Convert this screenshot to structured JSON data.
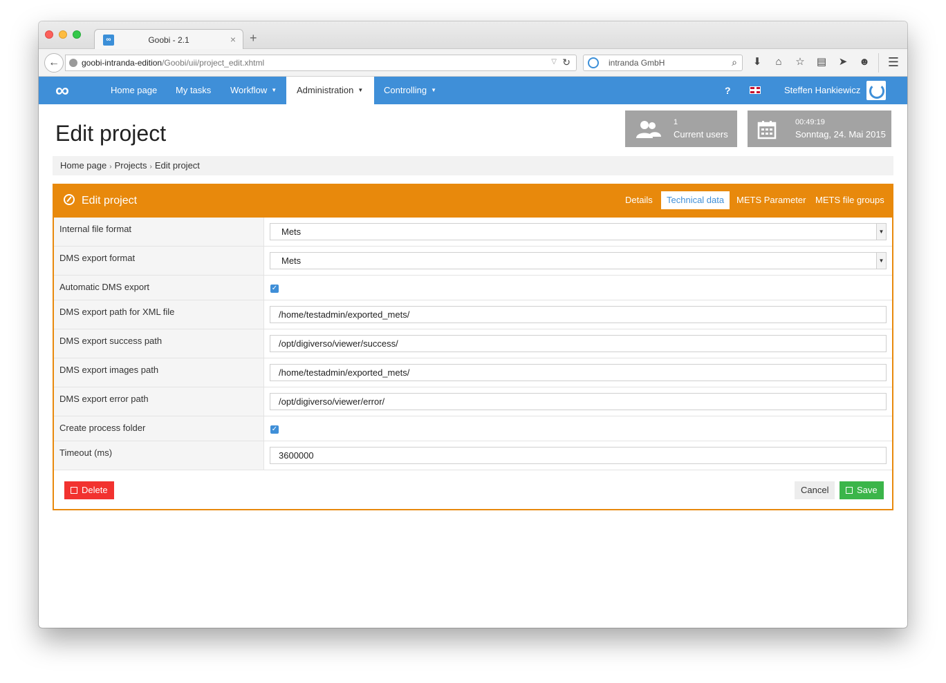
{
  "browser": {
    "tab_title": "Goobi - 2.1",
    "tab_favicon": "∞",
    "url_host": "goobi-intranda-edition",
    "url_path": "/Goobi/uii/project_edit.xhtml",
    "search_engine": "intranda GmbH"
  },
  "navbar": {
    "logo": "∞",
    "items": [
      {
        "label": "Home page"
      },
      {
        "label": "My tasks"
      },
      {
        "label": "Workflow"
      },
      {
        "label": "Administration"
      },
      {
        "label": "Controlling"
      }
    ],
    "help": "?",
    "user": "Steffen Hankiewicz"
  },
  "header": {
    "title": "Edit project",
    "users_count": "1",
    "users_label": "Current users",
    "time": "00:49:19",
    "date": "Sonntag, 24. Mai 2015"
  },
  "breadcrumb": [
    "Home page",
    "Projects",
    "Edit project"
  ],
  "panel": {
    "title": "Edit project",
    "tabs": [
      "Details",
      "Technical data",
      "METS Parameter",
      "METS file groups"
    ],
    "active_tab": "Technical data"
  },
  "form": {
    "internal_file_format": {
      "label": "Internal file format",
      "value": "Mets"
    },
    "dms_export_format": {
      "label": "DMS export format",
      "value": "Mets"
    },
    "automatic_dms_export": {
      "label": "Automatic DMS export",
      "checked": true
    },
    "dms_export_path_xml": {
      "label": "DMS export path for XML file",
      "value": "/home/testadmin/exported_mets/"
    },
    "dms_export_success_path": {
      "label": "DMS export success path",
      "value": "/opt/digiverso/viewer/success/"
    },
    "dms_export_images_path": {
      "label": "DMS export images path",
      "value": "/home/testadmin/exported_mets/"
    },
    "dms_export_error_path": {
      "label": "DMS export error path",
      "value": "/opt/digiverso/viewer/error/"
    },
    "create_process_folder": {
      "label": "Create process folder",
      "checked": true
    },
    "timeout": {
      "label": "Timeout (ms)",
      "value": "3600000"
    }
  },
  "actions": {
    "delete": "Delete",
    "cancel": "Cancel",
    "save": "Save"
  },
  "colors": {
    "nav_blue": "#3f8fd8",
    "panel_orange": "#e8890c",
    "delete_red": "#f2322f",
    "save_green": "#3bb54a"
  }
}
